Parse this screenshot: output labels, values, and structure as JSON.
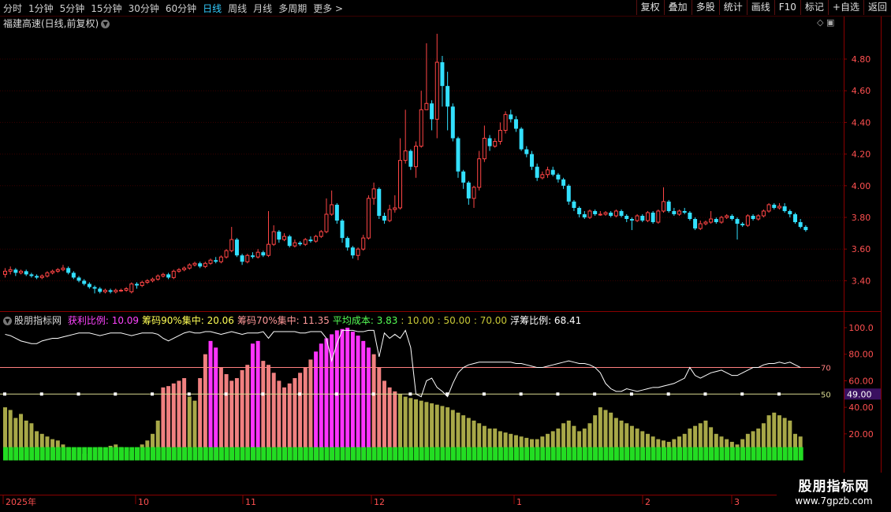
{
  "topbar": {
    "periods": [
      "分时",
      "1分钟",
      "5分钟",
      "15分钟",
      "30分钟",
      "60分钟",
      "日线",
      "周线",
      "月线",
      "多周期",
      "更多 >"
    ],
    "active_period": "日线",
    "tools": [
      "复权",
      "叠加",
      "多股",
      "统计",
      "画线",
      "F10",
      "标记",
      "+自选",
      "返回"
    ]
  },
  "price_panel": {
    "title": "福建高速(日线,前复权)",
    "yaxis_labels": [
      "4.80",
      "4.60",
      "4.40",
      "4.20",
      "4.00",
      "3.80",
      "3.60",
      "3.40"
    ]
  },
  "indicator_panel": {
    "name": "股朋指标网",
    "items": [
      {
        "label": "获利比例: ",
        "value": "10.09",
        "color": "#ff44ff"
      },
      {
        "label": "筹码90%集中: ",
        "value": "20.06",
        "color": "#ffff55"
      },
      {
        "label": "筹码70%集中: ",
        "value": "11.35",
        "color": "#ff9999"
      },
      {
        "label": "平均成本: ",
        "value": "3.83",
        "color": "#55ff55"
      },
      {
        "label": ": ",
        "value": "10.00",
        "color": "#c8c836"
      },
      {
        "label": ": ",
        "value": "50.00",
        "color": "#c8c836"
      },
      {
        "label": ": ",
        "value": "70.00",
        "color": "#c8c836"
      },
      {
        "label": "浮筹比例: ",
        "value": "68.41",
        "color": "#ffffff"
      }
    ],
    "yaxis_labels": [
      "100.0",
      "80.00",
      "60.00",
      "40.00",
      "20.00"
    ],
    "cursor_value": "49.00",
    "level_70_label": "70",
    "level_50_label": "50"
  },
  "date_axis": [
    "2025年",
    "10",
    "11",
    "12",
    "1",
    "2",
    "3"
  ],
  "watermark": {
    "line1": "股朋指标网",
    "line2": "www.7gpzb.com"
  },
  "colors": {
    "up": "#ff4545",
    "down": "#33e0ff",
    "magenta": "#ff33ff",
    "salmon": "#f08080",
    "olive": "#a8a848",
    "green": "#22dd22"
  },
  "chart_data": {
    "type": "candlestick",
    "title": "福建高速(日线,前复权)",
    "ohlc": [
      [
        3.44,
        3.46,
        3.48,
        3.42
      ],
      [
        3.46,
        3.47,
        3.49,
        3.44
      ],
      [
        3.47,
        3.45,
        3.48,
        3.43
      ],
      [
        3.45,
        3.46,
        3.47,
        3.44
      ],
      [
        3.46,
        3.44,
        3.47,
        3.43
      ],
      [
        3.44,
        3.43,
        3.45,
        3.42
      ],
      [
        3.43,
        3.42,
        3.44,
        3.41
      ],
      [
        3.42,
        3.43,
        3.44,
        3.41
      ],
      [
        3.43,
        3.45,
        3.46,
        3.42
      ],
      [
        3.45,
        3.46,
        3.47,
        3.44
      ],
      [
        3.46,
        3.47,
        3.48,
        3.45
      ],
      [
        3.47,
        3.48,
        3.5,
        3.46
      ],
      [
        3.48,
        3.45,
        3.49,
        3.44
      ],
      [
        3.45,
        3.42,
        3.46,
        3.41
      ],
      [
        3.42,
        3.4,
        3.43,
        3.39
      ],
      [
        3.4,
        3.38,
        3.41,
        3.37
      ],
      [
        3.38,
        3.36,
        3.39,
        3.35
      ],
      [
        3.36,
        3.35,
        3.37,
        3.32
      ],
      [
        3.35,
        3.33,
        3.36,
        3.32
      ],
      [
        3.33,
        3.34,
        3.35,
        3.32
      ],
      [
        3.34,
        3.33,
        3.35,
        3.32
      ],
      [
        3.33,
        3.34,
        3.35,
        3.32
      ],
      [
        3.34,
        3.34,
        3.35,
        3.33
      ],
      [
        3.34,
        3.35,
        3.36,
        3.33
      ],
      [
        3.33,
        3.38,
        3.39,
        3.32
      ],
      [
        3.38,
        3.37,
        3.39,
        3.35
      ],
      [
        3.37,
        3.39,
        3.4,
        3.36
      ],
      [
        3.39,
        3.4,
        3.41,
        3.38
      ],
      [
        3.4,
        3.41,
        3.42,
        3.39
      ],
      [
        3.41,
        3.43,
        3.44,
        3.4
      ],
      [
        3.43,
        3.44,
        3.45,
        3.42
      ],
      [
        3.44,
        3.42,
        3.45,
        3.41
      ],
      [
        3.42,
        3.46,
        3.47,
        3.41
      ],
      [
        3.46,
        3.47,
        3.48,
        3.45
      ],
      [
        3.47,
        3.48,
        3.49,
        3.46
      ],
      [
        3.48,
        3.5,
        3.51,
        3.47
      ],
      [
        3.5,
        3.51,
        3.52,
        3.49
      ],
      [
        3.51,
        3.49,
        3.52,
        3.48
      ],
      [
        3.49,
        3.51,
        3.52,
        3.48
      ],
      [
        3.51,
        3.53,
        3.54,
        3.5
      ],
      [
        3.53,
        3.52,
        3.55,
        3.51
      ],
      [
        3.52,
        3.55,
        3.56,
        3.51
      ],
      [
        3.55,
        3.59,
        3.6,
        3.54
      ],
      [
        3.59,
        3.66,
        3.74,
        3.58
      ],
      [
        3.66,
        3.56,
        3.67,
        3.55
      ],
      [
        3.56,
        3.52,
        3.57,
        3.5
      ],
      [
        3.52,
        3.56,
        3.57,
        3.51
      ],
      [
        3.56,
        3.55,
        3.58,
        3.54
      ],
      [
        3.55,
        3.58,
        3.6,
        3.54
      ],
      [
        3.58,
        3.56,
        3.59,
        3.55
      ],
      [
        3.56,
        3.63,
        3.84,
        3.55
      ],
      [
        3.63,
        3.71,
        3.75,
        3.62
      ],
      [
        3.71,
        3.66,
        3.72,
        3.64
      ],
      [
        3.66,
        3.68,
        3.7,
        3.65
      ],
      [
        3.68,
        3.62,
        3.69,
        3.61
      ],
      [
        3.62,
        3.64,
        3.66,
        3.61
      ],
      [
        3.64,
        3.63,
        3.65,
        3.62
      ],
      [
        3.63,
        3.66,
        3.67,
        3.62
      ],
      [
        3.66,
        3.65,
        3.68,
        3.64
      ],
      [
        3.65,
        3.68,
        3.69,
        3.64
      ],
      [
        3.68,
        3.71,
        3.72,
        3.67
      ],
      [
        3.71,
        3.82,
        3.92,
        3.7
      ],
      [
        3.82,
        3.88,
        3.97,
        3.81
      ],
      [
        3.88,
        3.78,
        3.89,
        3.76
      ],
      [
        3.78,
        3.67,
        3.79,
        3.64
      ],
      [
        3.67,
        3.61,
        3.68,
        3.59
      ],
      [
        3.61,
        3.56,
        3.62,
        3.54
      ],
      [
        3.56,
        3.6,
        3.61,
        3.53
      ],
      [
        3.6,
        3.67,
        3.69,
        3.59
      ],
      [
        3.67,
        3.92,
        3.94,
        3.66
      ],
      [
        3.92,
        3.98,
        4.02,
        3.88
      ],
      [
        3.98,
        3.81,
        3.99,
        3.79
      ],
      [
        3.81,
        3.78,
        3.83,
        3.76
      ],
      [
        3.78,
        3.85,
        3.88,
        3.77
      ],
      [
        3.85,
        3.86,
        3.94,
        3.83
      ],
      [
        3.86,
        4.16,
        4.3,
        3.85
      ],
      [
        4.16,
        4.22,
        4.48,
        4.14
      ],
      [
        4.22,
        4.12,
        4.23,
        4.1
      ],
      [
        4.12,
        4.25,
        4.28,
        4.05
      ],
      [
        4.25,
        4.48,
        4.6,
        4.24
      ],
      [
        4.48,
        4.52,
        4.9,
        4.48
      ],
      [
        4.52,
        4.42,
        4.54,
        4.35
      ],
      [
        4.42,
        4.78,
        4.96,
        4.3
      ],
      [
        4.78,
        4.63,
        4.82,
        4.5
      ],
      [
        4.63,
        4.5,
        4.72,
        4.35
      ],
      [
        4.5,
        4.3,
        4.52,
        4.28
      ],
      [
        4.3,
        4.09,
        4.31,
        4.05
      ],
      [
        4.09,
        4.02,
        4.1,
        3.98
      ],
      [
        4.02,
        3.92,
        4.03,
        3.88
      ],
      [
        3.92,
        3.99,
        4.0,
        3.86
      ],
      [
        3.99,
        4.17,
        4.22,
        3.97
      ],
      [
        4.17,
        4.3,
        4.38,
        4.15
      ],
      [
        4.3,
        4.25,
        4.32,
        4.22
      ],
      [
        4.25,
        4.28,
        4.3,
        4.24
      ],
      [
        4.28,
        4.35,
        4.4,
        4.26
      ],
      [
        4.35,
        4.45,
        4.47,
        4.33
      ],
      [
        4.45,
        4.42,
        4.48,
        4.4
      ],
      [
        4.42,
        4.36,
        4.44,
        4.34
      ],
      [
        4.36,
        4.23,
        4.37,
        4.22
      ],
      [
        4.23,
        4.2,
        4.25,
        4.18
      ],
      [
        4.2,
        4.12,
        4.22,
        4.1
      ],
      [
        4.12,
        4.05,
        4.14,
        4.03
      ],
      [
        4.05,
        4.07,
        4.09,
        4.04
      ],
      [
        4.07,
        4.1,
        4.12,
        4.05
      ],
      [
        4.1,
        4.07,
        4.12,
        4.06
      ],
      [
        4.07,
        4.04,
        4.08,
        4.02
      ],
      [
        4.04,
        4.0,
        4.05,
        3.98
      ],
      [
        4.0,
        3.9,
        4.01,
        3.88
      ],
      [
        3.9,
        3.86,
        3.91,
        3.84
      ],
      [
        3.86,
        3.82,
        3.87,
        3.8
      ],
      [
        3.82,
        3.8,
        3.84,
        3.79
      ],
      [
        3.8,
        3.84,
        3.85,
        3.79
      ],
      [
        3.84,
        3.82,
        3.85,
        3.81
      ],
      [
        3.82,
        3.82,
        3.84,
        3.81
      ],
      [
        3.82,
        3.83,
        3.84,
        3.81
      ],
      [
        3.83,
        3.81,
        3.84,
        3.8
      ],
      [
        3.81,
        3.84,
        3.85,
        3.8
      ],
      [
        3.84,
        3.81,
        3.85,
        3.8
      ],
      [
        3.81,
        3.79,
        3.82,
        3.77
      ],
      [
        3.79,
        3.78,
        3.8,
        3.72
      ],
      [
        3.78,
        3.81,
        3.82,
        3.77
      ],
      [
        3.81,
        3.78,
        3.82,
        3.77
      ],
      [
        3.78,
        3.83,
        3.84,
        3.77
      ],
      [
        3.83,
        3.77,
        3.84,
        3.76
      ],
      [
        3.77,
        3.84,
        3.85,
        3.76
      ],
      [
        3.84,
        3.9,
        3.99,
        3.83
      ],
      [
        3.9,
        3.84,
        3.91,
        3.83
      ],
      [
        3.84,
        3.82,
        3.86,
        3.81
      ],
      [
        3.82,
        3.84,
        3.85,
        3.81
      ],
      [
        3.84,
        3.83,
        3.86,
        3.82
      ],
      [
        3.83,
        3.79,
        3.84,
        3.78
      ],
      [
        3.79,
        3.73,
        3.8,
        3.72
      ],
      [
        3.73,
        3.76,
        3.78,
        3.72
      ],
      [
        3.76,
        3.77,
        3.78,
        3.75
      ],
      [
        3.77,
        3.79,
        3.84,
        3.76
      ],
      [
        3.79,
        3.77,
        3.8,
        3.76
      ],
      [
        3.77,
        3.8,
        3.81,
        3.76
      ],
      [
        3.8,
        3.81,
        3.82,
        3.79
      ],
      [
        3.81,
        3.79,
        3.82,
        3.78
      ],
      [
        3.79,
        3.76,
        3.8,
        3.66
      ],
      [
        3.76,
        3.75,
        3.77,
        3.74
      ],
      [
        3.75,
        3.81,
        3.82,
        3.74
      ],
      [
        3.81,
        3.79,
        3.82,
        3.78
      ],
      [
        3.79,
        3.81,
        3.82,
        3.78
      ],
      [
        3.81,
        3.84,
        3.85,
        3.8
      ],
      [
        3.84,
        3.88,
        3.89,
        3.83
      ],
      [
        3.88,
        3.86,
        3.89,
        3.85
      ],
      [
        3.86,
        3.87,
        3.89,
        3.85
      ],
      [
        3.87,
        3.84,
        3.89,
        3.83
      ],
      [
        3.84,
        3.82,
        3.85,
        3.8
      ],
      [
        3.82,
        3.77,
        3.83,
        3.76
      ],
      [
        3.77,
        3.74,
        3.79,
        3.73
      ],
      [
        3.74,
        3.72,
        3.75,
        3.71
      ]
    ],
    "profit_ratio": [
      40,
      38,
      32,
      35,
      30,
      28,
      22,
      20,
      18,
      16,
      15,
      12,
      10,
      8,
      6,
      5,
      5,
      8,
      10,
      9,
      11,
      12,
      10,
      8,
      7,
      9,
      12,
      15,
      20,
      30,
      55,
      56,
      58,
      60,
      62,
      48,
      45,
      62,
      80,
      90,
      85,
      70,
      65,
      60,
      62,
      68,
      72,
      88,
      90,
      75,
      72,
      66,
      60,
      55,
      58,
      62,
      66,
      70,
      76,
      82,
      88,
      92,
      95,
      98,
      99,
      100,
      97,
      94,
      90,
      85,
      80,
      70,
      60,
      55,
      52,
      50,
      48,
      47,
      46,
      45,
      44,
      43,
      42,
      41,
      40,
      38,
      36,
      34,
      32,
      30,
      28,
      26,
      24,
      24,
      22,
      21,
      20,
      19,
      18,
      17,
      16,
      16,
      18,
      20,
      22,
      24,
      28,
      30,
      26,
      22,
      24,
      28,
      34,
      40,
      38,
      36,
      32,
      30,
      28,
      26,
      24,
      22,
      20,
      18,
      16,
      15,
      14,
      16,
      18,
      20,
      24,
      26,
      28,
      30,
      25,
      20,
      18,
      16,
      14,
      12,
      16,
      20,
      22,
      24,
      28,
      34,
      36,
      34,
      32,
      30,
      20,
      18
    ],
    "float_ratio": [
      95,
      94,
      92,
      90,
      89,
      88,
      88,
      90,
      91,
      92,
      92,
      93,
      94,
      95,
      96,
      96,
      96,
      95,
      94,
      95,
      96,
      96,
      96,
      95,
      94,
      95,
      96,
      96,
      96,
      95,
      92,
      90,
      92,
      94,
      96,
      97,
      96,
      96,
      97,
      97,
      96,
      95,
      96,
      97,
      96,
      95,
      96,
      96,
      96,
      97,
      92,
      97,
      97,
      97,
      97,
      97,
      96,
      96,
      97,
      97,
      97,
      92,
      75,
      88,
      98,
      98,
      98,
      97,
      97,
      98,
      98,
      78,
      96,
      92,
      95,
      92,
      98,
      85,
      50,
      48,
      60,
      62,
      55,
      52,
      48,
      58,
      66,
      70,
      72,
      73,
      74,
      74,
      74,
      74,
      74,
      74,
      74,
      73,
      73,
      72,
      71,
      70,
      70,
      71,
      72,
      73,
      74,
      75,
      74,
      73,
      73,
      72,
      70,
      66,
      58,
      54,
      52,
      52,
      54,
      53,
      52,
      53,
      54,
      55,
      55,
      56,
      57,
      58,
      60,
      62,
      70,
      64,
      62,
      64,
      66,
      67,
      68,
      66,
      64,
      64,
      66,
      68,
      70,
      70,
      72,
      73,
      73,
      74,
      73,
      74,
      72,
      70
    ],
    "value_labels": {
      "profit": "10.09",
      "chip90": "20.06",
      "chip70": "11.35",
      "avg_cost": "3.83",
      "float": "68.41"
    }
  }
}
